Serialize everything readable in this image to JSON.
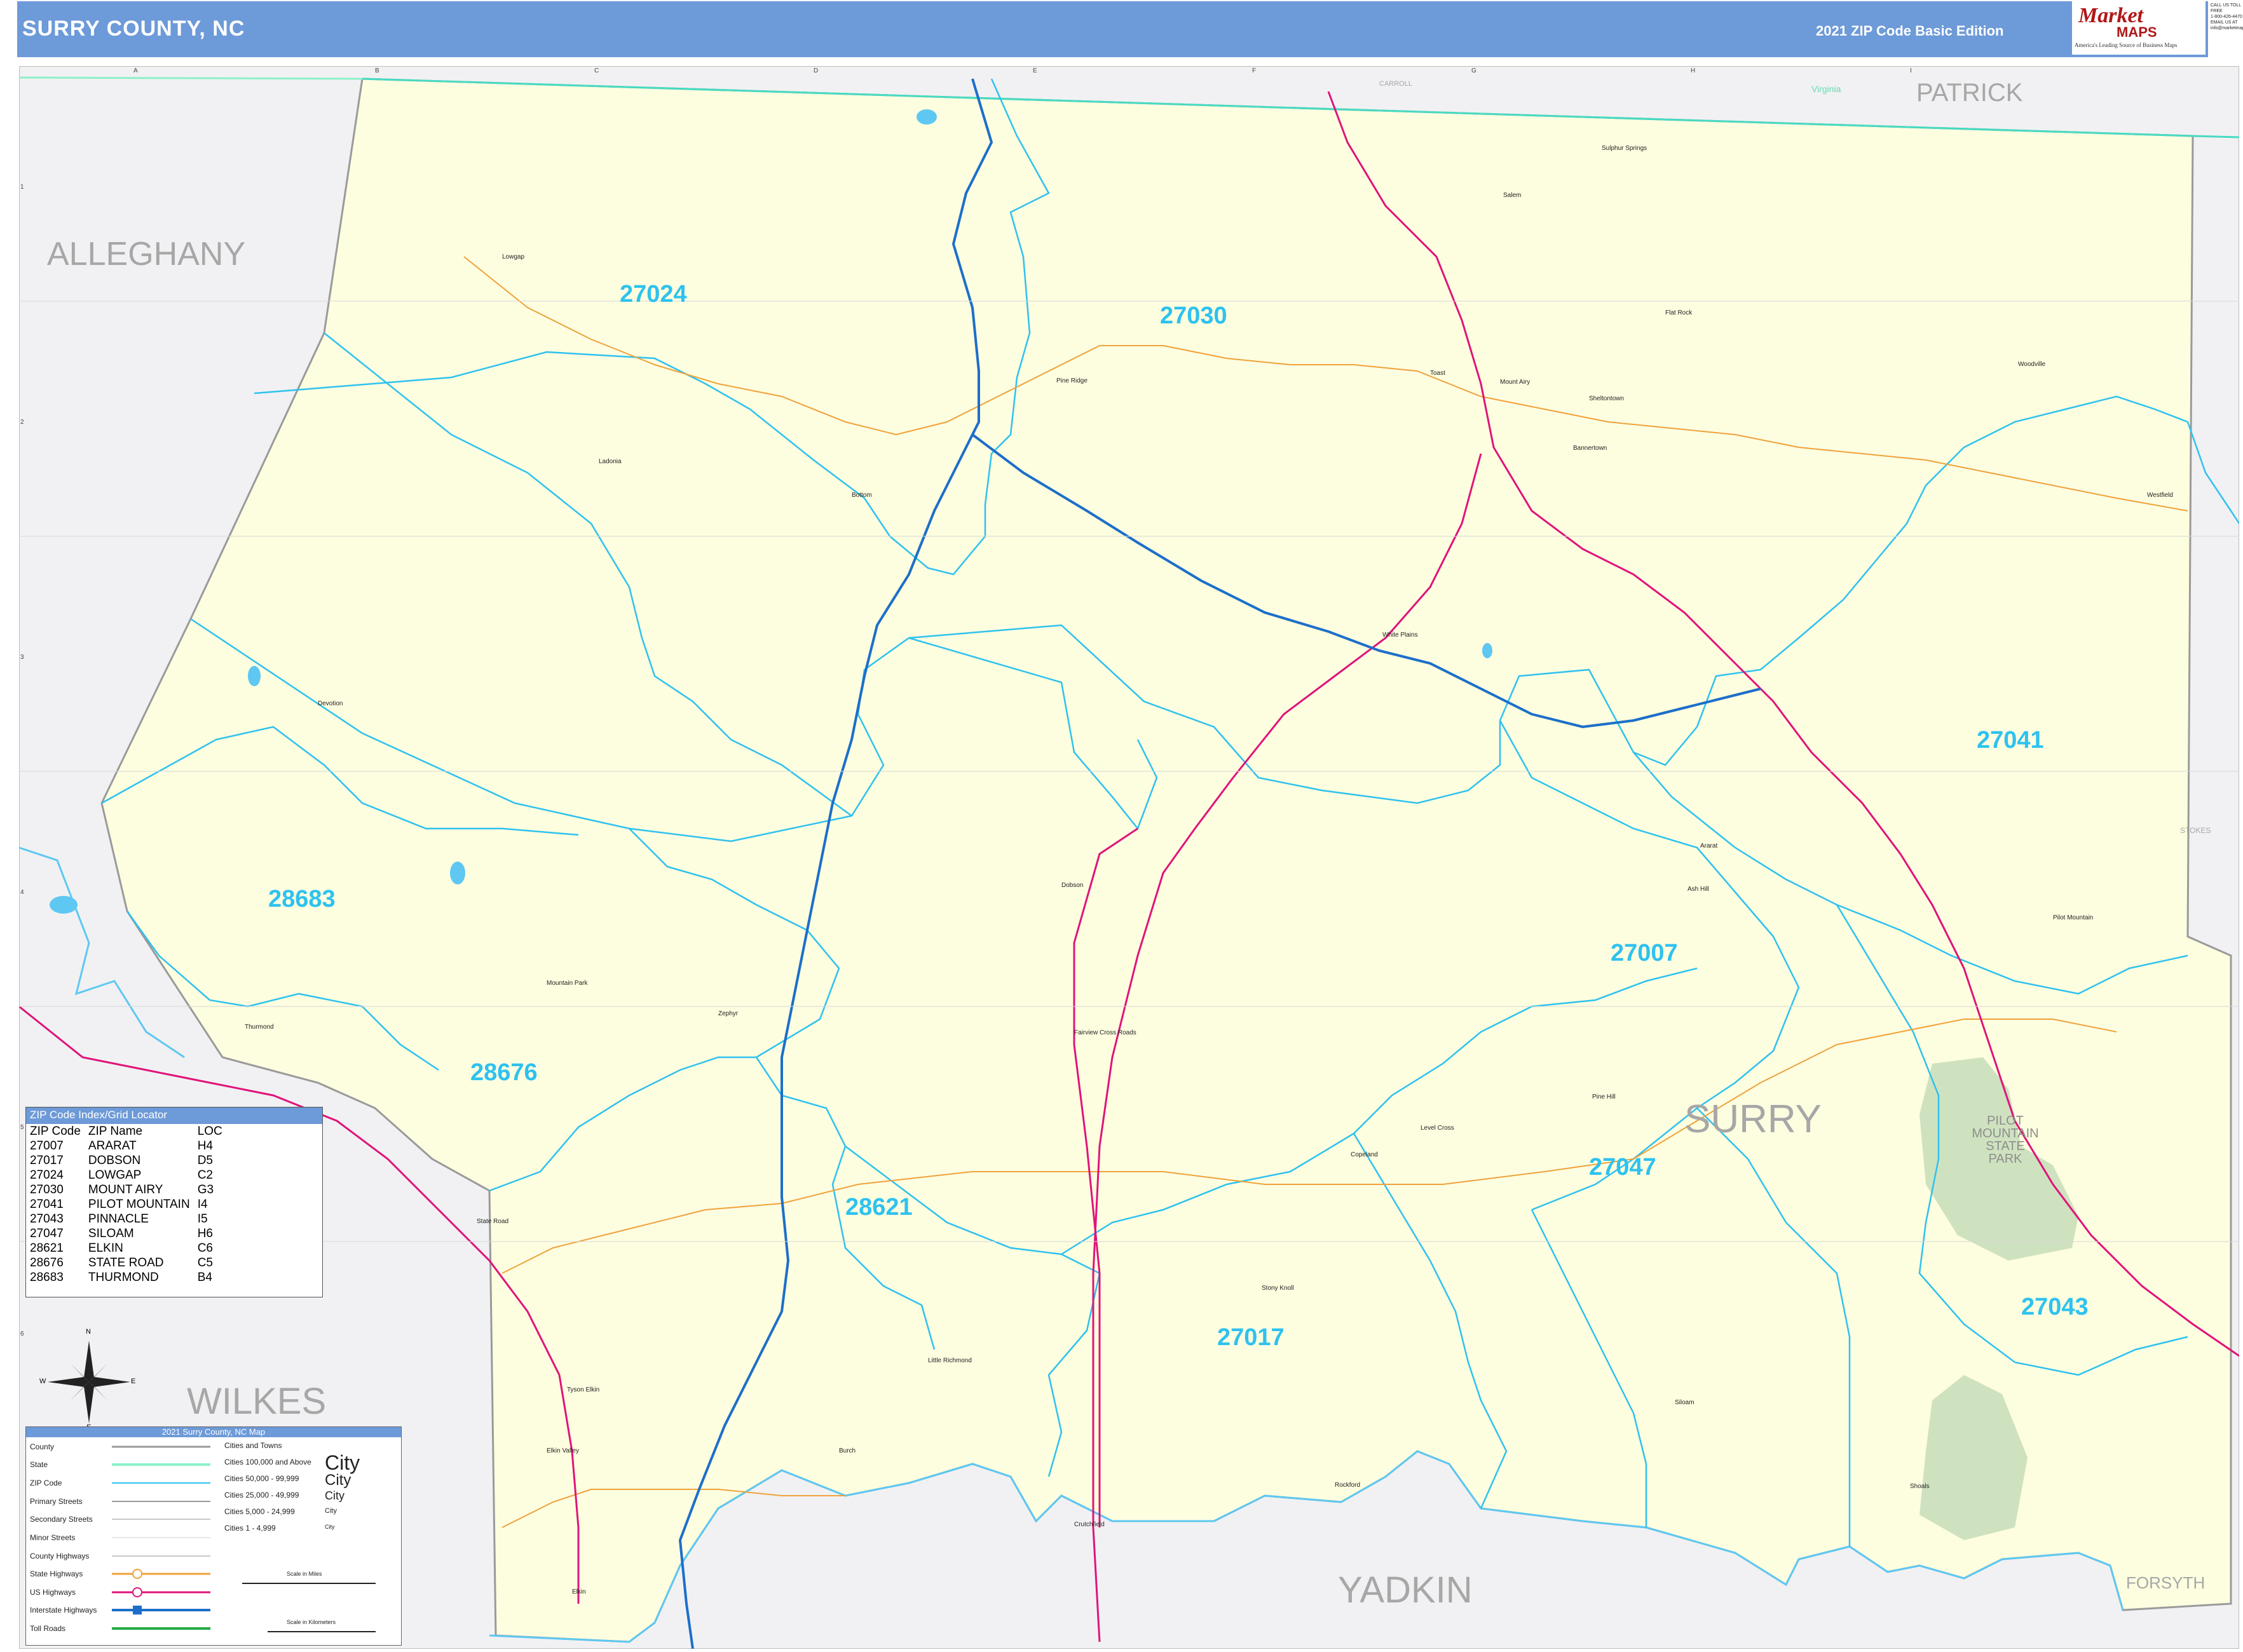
{
  "header": {
    "title": "SURRY COUNTY, NC",
    "edition": "2021 ZIP Code Basic Edition",
    "logo_market": "Market",
    "logo_maps": "MAPS",
    "logo_tagline": "America's Leading Source of Business Maps",
    "contact_lines": [
      "CALL US TOLL FREE",
      "1-800-426-4470",
      "EMAIL US AT",
      "info@marketmaps.com"
    ]
  },
  "colors": {
    "header": "#6d9ad8",
    "county_fill": "#fdfde0",
    "outside": "#f1f1f3",
    "zip_boundary": "#2ec2ef",
    "interstate": "#1c6fc9",
    "us_highway": "#e0147a",
    "state_highway": "#f0a23a",
    "water": "#5ec8f2",
    "park": "#cfe2c0"
  },
  "grid": {
    "columns": [
      "A",
      "B",
      "C",
      "D",
      "E",
      "F",
      "G",
      "H",
      "I"
    ],
    "rows": [
      "1",
      "2",
      "3",
      "4",
      "5",
      "6"
    ]
  },
  "regions": {
    "alleghany": "ALLEGHANY",
    "wilkes": "WILKES",
    "yadkin": "YADKIN",
    "patrick": "PATRICK",
    "forsyth": "FORSYTH",
    "surry": "SURRY",
    "carroll": "CARROLL",
    "stokes": "STOKES",
    "virginia": "Virginia"
  },
  "zip_labels": {
    "z27024": "27024",
    "z27030": "27030",
    "z27041": "27041",
    "z28683": "28683",
    "z27007": "27007",
    "z28676": "28676",
    "z27047": "27047",
    "z28621": "28621",
    "z27043": "27043",
    "z27017": "27017"
  },
  "park": {
    "name_lines": [
      "PILOT",
      "MOUNTAIN",
      "STATE",
      "PARK"
    ]
  },
  "towns": {
    "lowgap": "Lowgap",
    "ladonia": "Ladonia",
    "bottom": "Bottom",
    "pine_ridge": "Pine Ridge",
    "salem": "Salem",
    "sulphur_springs": "Sulphur Springs",
    "flat_rock": "Flat Rock",
    "toast": "Toast",
    "mount_airy": "Mount Airy",
    "shelton": "Sheltontown",
    "bannertown": "Bannertown",
    "woodville": "Woodville",
    "westfield": "Westfield",
    "white_plains": "White Plains",
    "devotion": "Devotion",
    "dobson": "Dobson",
    "ararat": "Ararat",
    "ash_hill": "Ash Hill",
    "pilot_mountain": "Pilot Mountain",
    "mountain_park": "Mountain Park",
    "zephyr": "Zephyr",
    "fairview": "Fairview Cross Roads",
    "thurmond": "Thurmond",
    "level_cross": "Level Cross",
    "pine_hill": "Pine Hill",
    "copeland": "Copeland",
    "state_road": "State Road",
    "stony_knoll": "Stony Knoll",
    "little_richmond": "Little Richmond",
    "siloam": "Siloam",
    "shoals": "Shoals",
    "crutchfield": "Crutchfield",
    "rockford": "Rockford",
    "burch": "Burch",
    "elkin": "Elkin",
    "elkin_valley": "Elkin Valley",
    "tyson_elkin": "Tyson Elkin"
  },
  "zip_index": {
    "title": "ZIP Code Index/Grid Locator",
    "columns": [
      "ZIP Code",
      "ZIP Name",
      "LOC"
    ],
    "rows": [
      [
        "27007",
        "ARARAT",
        "H4"
      ],
      [
        "27017",
        "DOBSON",
        "D5"
      ],
      [
        "27024",
        "LOWGAP",
        "C2"
      ],
      [
        "27030",
        "MOUNT AIRY",
        "G3"
      ],
      [
        "27041",
        "PILOT MOUNTAIN",
        "I4"
      ],
      [
        "27043",
        "PINNACLE",
        "I5"
      ],
      [
        "27047",
        "SILOAM",
        "H6"
      ],
      [
        "28621",
        "ELKIN",
        "C6"
      ],
      [
        "28676",
        "STATE ROAD",
        "C5"
      ],
      [
        "28683",
        "THURMOND",
        "B4"
      ]
    ]
  },
  "legend": {
    "title": "2021 Surry County, NC Map",
    "items": [
      "County",
      "State",
      "ZIP Code",
      "Primary Streets",
      "Secondary Streets",
      "Minor Streets",
      "County Highways",
      "State Highways",
      "US Highways",
      "Interstate Highways",
      "Toll Roads"
    ],
    "cities_title": "Cities and Towns",
    "city_sizes": [
      "Cities 100,000 and Above",
      "Cities 50,000 - 99,999",
      "Cities 25,000 - 49,999",
      "Cities 5,000 - 24,999",
      "Cities 1 - 4,999"
    ],
    "city_word": "City",
    "scale_miles": "Scale in Miles",
    "scale_km": "Scale in Kilometers"
  },
  "compass": {
    "n": "N",
    "s": "S",
    "e": "E",
    "w": "W"
  }
}
